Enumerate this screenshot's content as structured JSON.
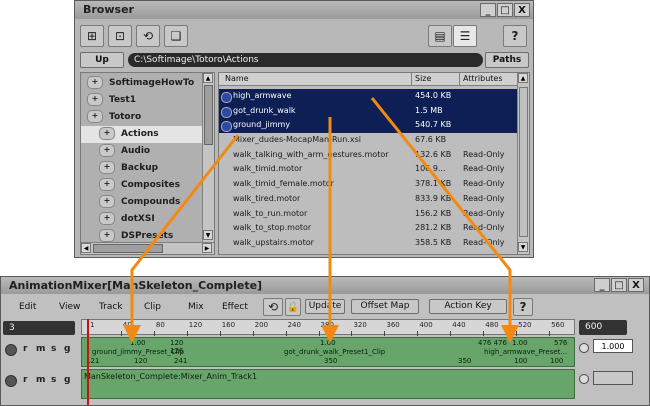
{
  "browser": {
    "title": "Browser",
    "window_buttons": [
      "_",
      "□",
      "X"
    ],
    "up_label": "Up",
    "path": "C:\\Softimage\\Totoro\\Actions",
    "paths_label": "Paths",
    "help_label": "?",
    "tree": [
      {
        "label": "SoftimageHowTo",
        "selected": false
      },
      {
        "label": "Test1",
        "selected": false
      },
      {
        "label": "Totoro",
        "selected": false
      },
      {
        "label": "Actions",
        "selected": true
      },
      {
        "label": "Audio",
        "selected": false
      },
      {
        "label": "Backup",
        "selected": false
      },
      {
        "label": "Composites",
        "selected": false
      },
      {
        "label": "Compounds",
        "selected": false
      },
      {
        "label": "dotXSI",
        "selected": false
      },
      {
        "label": "DSPresets",
        "selected": false
      }
    ],
    "columns": {
      "name": "Name",
      "size": "Size",
      "attributes": "Attributes"
    },
    "files": [
      {
        "name": "high_armwave",
        "size": "454.0 KB",
        "attr": "",
        "selected": true
      },
      {
        "name": "got_drunk_walk",
        "size": "1.5 MB",
        "attr": "",
        "selected": true
      },
      {
        "name": "ground_jimmy",
        "size": "540.7 KB",
        "attr": "",
        "selected": true
      },
      {
        "name": "Mixer_dudes-MocapMan-Run.xsi",
        "size": "67.6 KB",
        "attr": "",
        "selected": false
      },
      {
        "name": "walk_talking_with_arm_gestures.motor",
        "size": "132.6 KB",
        "attr": "Read-Only",
        "selected": false
      },
      {
        "name": "walk_timid.motor",
        "size": "106.9...",
        "attr": "Read-Only",
        "selected": false
      },
      {
        "name": "walk_timid_female.motor",
        "size": "378.1 KB",
        "attr": "Read-Only",
        "selected": false
      },
      {
        "name": "walk_tired.motor",
        "size": "833.9 KB",
        "attr": "Read-Only",
        "selected": false
      },
      {
        "name": "walk_to_run.motor",
        "size": "156.2 KB",
        "attr": "Read-Only",
        "selected": false
      },
      {
        "name": "walk_to_stop.motor",
        "size": "281.2 KB",
        "attr": "Read-Only",
        "selected": false
      },
      {
        "name": "walk_upstairs.motor",
        "size": "358.5 KB",
        "attr": "Read-Only",
        "selected": false
      }
    ]
  },
  "mixer": {
    "title": "AnimationMixer[ManSkeleton_Complete]",
    "window_buttons": [
      "_",
      "□",
      "X"
    ],
    "menus": [
      "Edit",
      "View",
      "Track",
      "Clip",
      "Mix",
      "Effect"
    ],
    "update_label": "Update",
    "offset_map_label": "Offset Map",
    "action_key_label": "Action Key",
    "help_label": "?",
    "start_frame": "3",
    "end_frame": "600",
    "ruler_ticks": [
      "1",
      "40",
      "80",
      "120",
      "160",
      "200",
      "240",
      "280",
      "320",
      "360",
      "400",
      "440",
      "480",
      "520",
      "560"
    ],
    "track1_letters": [
      "r",
      "m",
      "s",
      "g"
    ],
    "track2_letters": [
      "r",
      "m",
      "s",
      "g"
    ],
    "clips": [
      {
        "name": "ground_jimmy_Preset_Clip",
        "weight": "1.00",
        "start": "121",
        "end": "240",
        "start_top": "",
        "end_top": "120 126",
        "mid": "120",
        "mid2": "241"
      },
      {
        "name": "got_drunk_walk_Preset1_Clip",
        "weight": "1.00",
        "mid": "350",
        "end": "350",
        "end2": "1"
      },
      {
        "name": "high_armwave_Preset...",
        "weight": "1.00",
        "start_top": "476 476",
        "end_top": "576",
        "mid": "100",
        "end": "100"
      }
    ],
    "track2_label": "ManSkeleton_Complete:Mixer_Anim_Track1",
    "weight_value": "1.000"
  }
}
